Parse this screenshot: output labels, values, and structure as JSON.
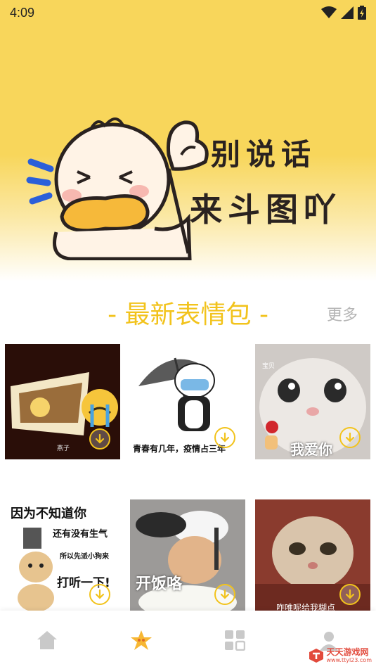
{
  "status_bar": {
    "time": "4:09"
  },
  "hero": {
    "line1": "别说话",
    "line2": "来斗图吖"
  },
  "section": {
    "title": "- 最新表情包 -",
    "more": "更多"
  },
  "cards": [
    {
      "caption": "燕子"
    },
    {
      "caption": "青春有几年，疫情占三年"
    },
    {
      "caption": "我爱你",
      "tag": "宝贝"
    },
    {
      "caption": "因为不知道你",
      "sub1": "还有没有生气",
      "sub2": "所以先派小狗来",
      "sub3": "打听一下!"
    },
    {
      "caption": "开饭咯"
    },
    {
      "caption": "咋唯呢给我糊点"
    }
  ],
  "bottom_nav": [
    "home-icon",
    "star-icon",
    "grid-icon",
    "profile-icon"
  ],
  "watermark": {
    "name": "天天游戏网",
    "url": "www.ttyl23.com"
  },
  "colors": {
    "accent": "#f2c31c",
    "hero_bg": "#f8d65b"
  }
}
